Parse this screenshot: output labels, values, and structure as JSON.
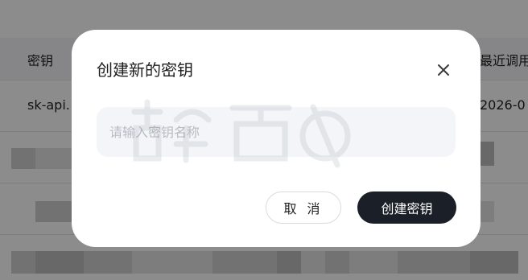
{
  "background_table": {
    "column_key": "密钥",
    "column_last_used": "最近调用",
    "row1_key": "sk-api.",
    "row1_date": "2026-0"
  },
  "modal": {
    "title": "创建新的密钥",
    "close_icon": "close-icon",
    "input": {
      "placeholder": "请输入密钥名称",
      "value": ""
    },
    "cancel_label": "取 消",
    "create_label": "创建密钥"
  },
  "colors": {
    "overlay": "rgba(0,0,0,0.45)",
    "primary_button": "#1b1f27",
    "input_bg": "#f3f5f8"
  }
}
